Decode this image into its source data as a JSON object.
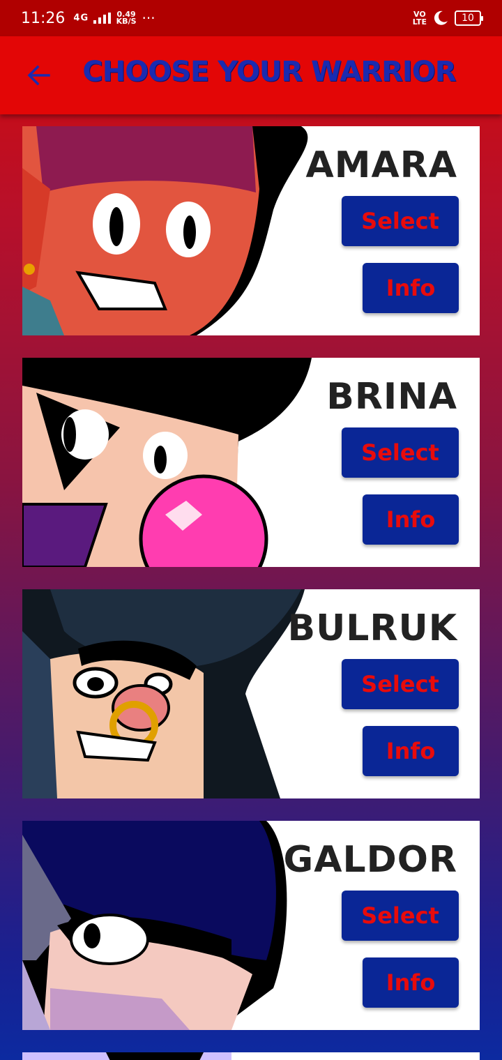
{
  "status_bar": {
    "time": "11:26",
    "network": "4G",
    "speed_value": "0.49",
    "speed_unit": "KB/S",
    "dots": "···",
    "volte_top": "VO",
    "volte_bottom": "LTE",
    "battery": "10"
  },
  "app_bar": {
    "title": "CHOOSE YOUR WARRIOR",
    "back_icon": "arrow-left-icon"
  },
  "colors": {
    "accent_red": "#e30606",
    "button_blue": "#0a2696",
    "button_text_red": "#e80b0b",
    "title_blue": "#1a2bb0"
  },
  "warriors": [
    {
      "name": "AMARA",
      "select_label": "Select",
      "info_label": "Info"
    },
    {
      "name": "BRINA",
      "select_label": "Select",
      "info_label": "Info"
    },
    {
      "name": "BULRUK",
      "select_label": "Select",
      "info_label": "Info"
    },
    {
      "name": "GALDOR",
      "select_label": "Select",
      "info_label": "Info"
    }
  ]
}
